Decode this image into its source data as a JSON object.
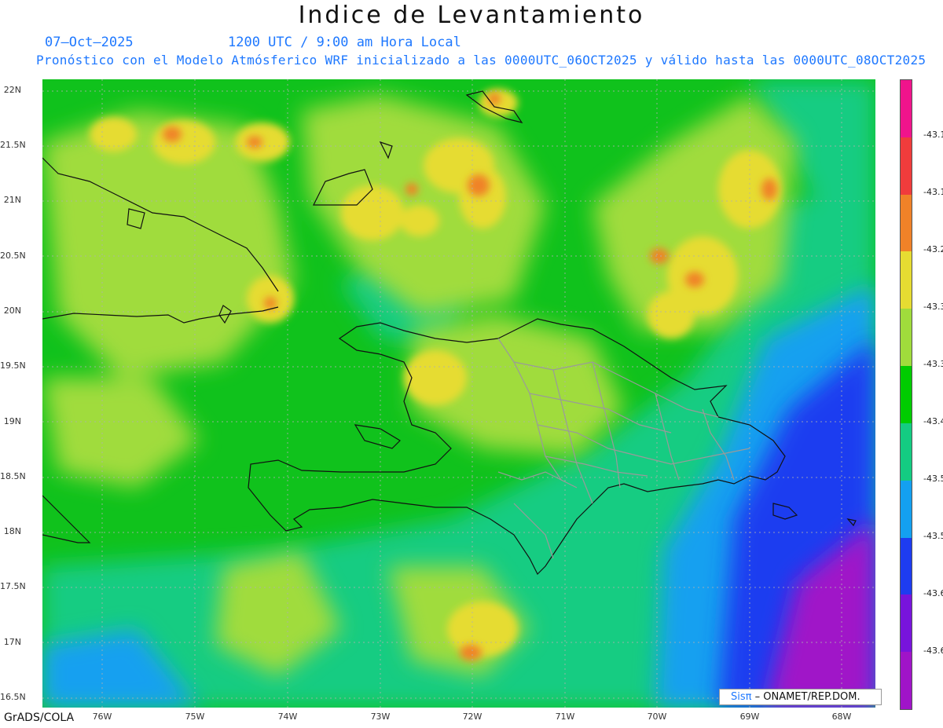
{
  "title": "Indice de Levantamiento",
  "date": "07–Oct–2025",
  "time": "1200 UTC / 9:00 am Hora Local",
  "description": "Pronóstico con el Modelo Atmósferico WRF inicializado a las 0000UTC_06OCT2025 y válido hasta las  0000UTC_08OCT2025",
  "y_ticks": [
    "22N",
    "21.5N",
    "21N",
    "20.5N",
    "20N",
    "19.5N",
    "19N",
    "18.5N",
    "18N",
    "17.5N",
    "17N",
    "16.5N"
  ],
  "x_ticks": [
    "76W",
    "75W",
    "74W",
    "73W",
    "72W",
    "71W",
    "70W",
    "69W",
    "68W"
  ],
  "colorbar": {
    "colors": [
      "#f0148c",
      "#f03c3c",
      "#f08228",
      "#e6dc32",
      "#a0dc3c",
      "#00cc00",
      "#14cc82",
      "#14a0f0",
      "#1e3cf0",
      "#7814dc",
      "#a014c8"
    ],
    "labels": [
      "-43.1",
      "-43.1",
      "-43.2",
      "-43.3",
      "-43.3",
      "-43.4",
      "-43.5",
      "-43.5",
      "-43.6",
      "-43.6"
    ]
  },
  "credit": {
    "brand": "Sisπ",
    "org": "– ONAMET/REP.DOM."
  },
  "footer": "GrADS/COLA"
}
